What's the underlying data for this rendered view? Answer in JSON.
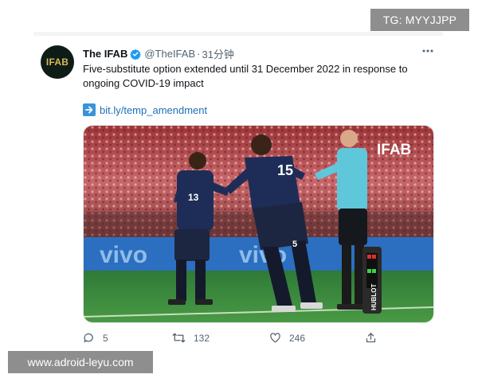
{
  "overlay": {
    "tg_badge": "TG: MYYJJPP",
    "watermark": "www.adroid-leyu.com"
  },
  "tweet": {
    "avatar_text": "IFAB",
    "author_name": "The IFAB",
    "handle": "@TheIFAB",
    "separator": "·",
    "time": "31分钟",
    "text": "Five-substitute option extended until 31 December 2022 in response to ongoing COVID-19 impact",
    "link_text": "bit.ly/temp_amendment",
    "media": {
      "logo_text": "IFAB",
      "player_left_number": "13",
      "player_right_number": "15",
      "player_right_lower_number": "5",
      "ad_text_left": "vivo",
      "ad_text_right": "vivo",
      "board_text": "HUBLOT"
    }
  },
  "actions": {
    "replies": "5",
    "retweets": "132",
    "likes": "246"
  },
  "icons": {
    "verified": "verified-badge-icon",
    "more": "more-options-icon",
    "link_arrow": "right-arrow-icon",
    "reply": "reply-icon",
    "retweet": "retweet-icon",
    "like": "heart-icon",
    "share": "share-icon"
  },
  "colors": {
    "verified_blue": "#1d9bf0",
    "link_blue": "#1d6fb8",
    "france_navy": "#1e2d57",
    "referee_cyan": "#5fc7da"
  }
}
